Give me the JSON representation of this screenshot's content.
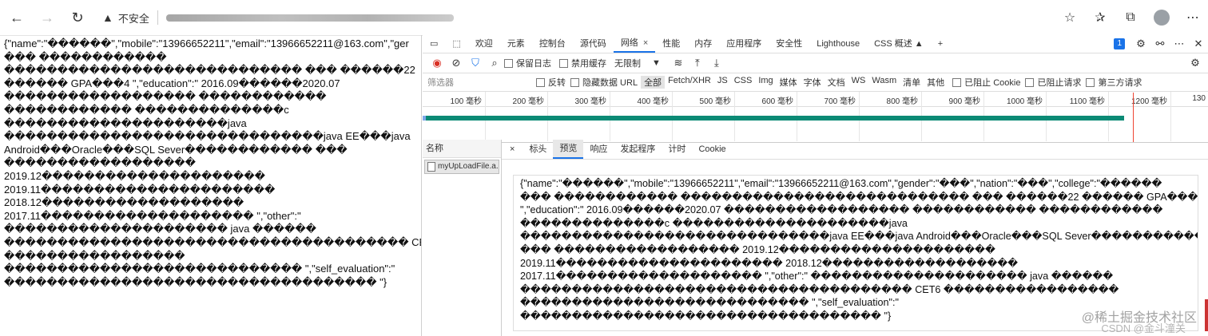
{
  "browser": {
    "insecure_label": "不安全",
    "icons": {
      "back": "back-arrow-icon",
      "forward": "forward-arrow-icon",
      "reload": "reload-icon",
      "warning": "warning-icon",
      "favorites_add": "star-plus-icon",
      "favorites": "favorites-icon",
      "collections": "collections-icon",
      "profile": "avatar"
    }
  },
  "left_response": {
    "lines": [
      "{\"name\":\"������\",\"mobile\":\"13966652211\",\"email\":\"13966652211@163.com\",\"ger",
      "��� ������������",
      "���������������������������� ��� ������22",
      "������ GPA���4 \",\"education\":\" 2016.09������2020.07",
      "������������������ ������������",
      "������������ ��������������c",
      "���������������������java",
      "������������������������������java EE���java",
      "Android���Oracle���SQL Sever������������ ���",
      "������������������",
      "2019.12���������������������",
      "2019.11����������������������",
      "2018.12�������������������",
      "2017.11�������������������� \",\"other\":\"",
      "��������������������� java ������",
      "�������������������������������������� CET6",
      "�����������������",
      "���������������������������� \",\"self_evaluation\":\"",
      "����������������������������������� \"}"
    ]
  },
  "devtools": {
    "tabs": [
      {
        "label": "欢迎",
        "active": false
      },
      {
        "label": "元素",
        "active": false
      },
      {
        "label": "控制台",
        "active": false
      },
      {
        "label": "源代码",
        "active": false
      },
      {
        "label": "网络",
        "active": true,
        "close": "×"
      },
      {
        "label": "性能",
        "active": false
      },
      {
        "label": "内存",
        "active": false
      },
      {
        "label": "应用程序",
        "active": false
      },
      {
        "label": "安全性",
        "active": false
      },
      {
        "label": "Lighthouse",
        "active": false
      },
      {
        "label": "CSS 概述 ▲",
        "active": false
      }
    ],
    "add_tab": "+",
    "issues_badge": "1",
    "toolbar": {
      "preserve_log": "保留日志",
      "disable_cache": "禁用缓存",
      "throttle": "无限制"
    },
    "filter": {
      "placeholder": "筛选器",
      "invert": "反转",
      "hide_data_urls": "隐藏数据 URL",
      "types": [
        "全部",
        "Fetch/XHR",
        "JS",
        "CSS",
        "Img",
        "媒体",
        "字体",
        "文档",
        "WS",
        "Wasm",
        "清单",
        "其他"
      ],
      "blocked_cookies": "已阻止 Cookie",
      "blocked_requests": "已阻止请求",
      "third_party": "第三方请求"
    },
    "timeline": {
      "ticks": [
        "100 毫秒",
        "200 毫秒",
        "300 毫秒",
        "400 毫秒",
        "500 毫秒",
        "600 毫秒",
        "700 毫秒",
        "800 毫秒",
        "900 毫秒",
        "1000 毫秒",
        "1100 毫秒",
        "1200 毫秒",
        "130"
      ]
    },
    "requests": {
      "name_header": "名称",
      "items": [
        "myUpLoadFile.a..."
      ]
    },
    "detail_tabs": {
      "close": "×",
      "items": [
        {
          "label": "标头",
          "active": false
        },
        {
          "label": "预览",
          "active": true
        },
        {
          "label": "响应",
          "active": false
        },
        {
          "label": "发起程序",
          "active": false
        },
        {
          "label": "计时",
          "active": false
        },
        {
          "label": "Cookie",
          "active": false
        }
      ]
    },
    "preview_lines": [
      "{\"name\":\"������\",\"mobile\":\"13966652211\",\"email\":\"13966652211@163.com\",\"gender\":\"���\",\"nation\":\"���\",\"college\":\"������",
      "��� ������������ ���������������������������� ��� ������22 ������ GPA���4",
      "\",\"education\":\" 2016.09������2020.07 ������������������ ������������ ������������",
      "��������������c ���������������������java",
      "������������������������������java EE���java Android���Oracle���SQL Sever������������",
      "��� ������������������ 2019.12���������������������",
      "2019.11���������������������� 2018.12�������������������",
      "2017.11�������������������� \",\"other\":\" ��������������������� java ������",
      "�������������������������������������� CET6 �����������������",
      "���������������������������� \",\"self_evaluation\":\"",
      "����������������������������������� \"}"
    ]
  },
  "watermark": {
    "line1": "@稀土掘金技术社区",
    "line2": "CSDN @金斗潼关"
  }
}
